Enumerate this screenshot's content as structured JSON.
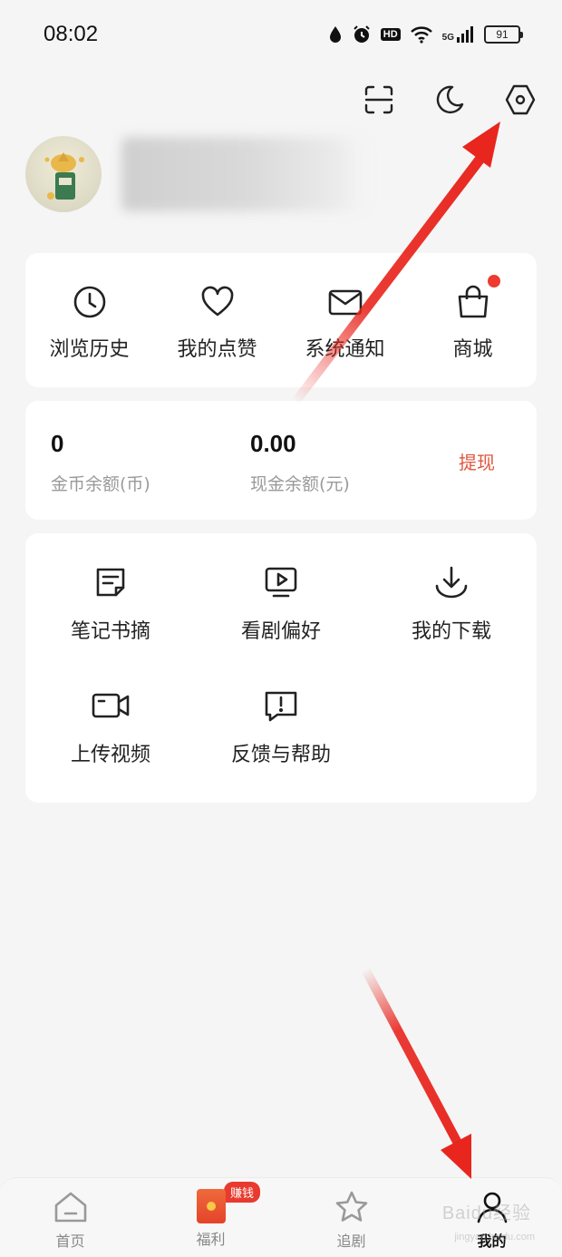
{
  "status_bar": {
    "time": "08:02",
    "hd_label": "HD",
    "network_label": "5G",
    "battery": "91"
  },
  "header": {
    "actions": [
      "scan-icon",
      "moon-icon",
      "settings-icon"
    ]
  },
  "quick_actions": [
    {
      "label": "浏览历史",
      "icon": "clock-icon"
    },
    {
      "label": "我的点赞",
      "icon": "heart-icon"
    },
    {
      "label": "系统通知",
      "icon": "mail-icon"
    },
    {
      "label": "商城",
      "icon": "shopping-bag-icon",
      "has_dot": true
    }
  ],
  "wallet": {
    "coins_value": "0",
    "coins_label": "金币余额(币)",
    "cash_value": "0.00",
    "cash_label": "现金余额(元)",
    "withdraw_label": "提现"
  },
  "tools": [
    {
      "label": "笔记书摘",
      "icon": "note-icon"
    },
    {
      "label": "看剧偏好",
      "icon": "play-screen-icon"
    },
    {
      "label": "我的下载",
      "icon": "download-icon"
    },
    {
      "label": "上传视频",
      "icon": "video-camera-icon"
    },
    {
      "label": "反馈与帮助",
      "icon": "feedback-icon"
    }
  ],
  "bottom_nav": {
    "items": [
      {
        "label": "首页",
        "icon": "home-icon"
      },
      {
        "label": "福利",
        "icon": "red-packet-icon",
        "badge": "赚钱"
      },
      {
        "label": "追剧",
        "icon": "star-icon"
      },
      {
        "label": "我的",
        "icon": "user-icon",
        "active": true
      }
    ]
  },
  "watermark": {
    "text": "Baidu经验",
    "sub": "jingyan.baidu.com"
  },
  "colors": {
    "background": "#f5f5f5",
    "card": "#ffffff",
    "accent": "#e0563f",
    "badge_red": "#e83a2e",
    "annotation_arrow": "#e8261e"
  }
}
